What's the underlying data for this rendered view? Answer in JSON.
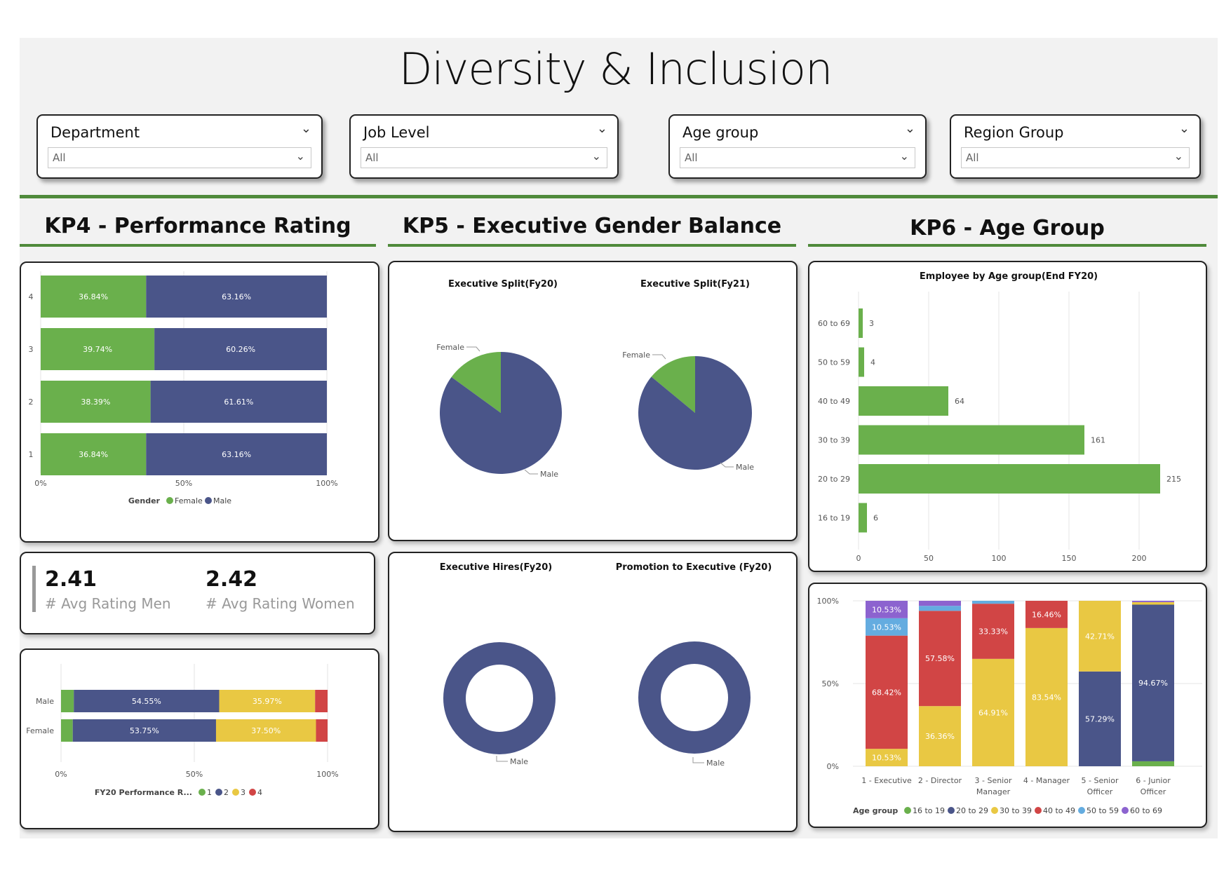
{
  "page_title": "Diversity & Inclusion",
  "filters": [
    {
      "label": "Department",
      "value": "All"
    },
    {
      "label": "Job Level",
      "value": "All"
    },
    {
      "label": "Age group",
      "value": "All"
    },
    {
      "label": "Region Group",
      "value": "All"
    }
  ],
  "sections": {
    "kp4": "KP4 - Performance Rating",
    "kp5": "KP5 - Executive Gender Balance",
    "kp6": "KP6 - Age Group"
  },
  "kpis": {
    "men_value": "2.41",
    "men_label": "# Avg Rating Men",
    "women_value": "2.42",
    "women_label": "# Avg Rating Women"
  },
  "colors": {
    "green": "#6ab04c",
    "blue": "#4a5589",
    "yellow": "#e9c843",
    "red": "#d14545",
    "lightblue": "#64ace0",
    "purple": "#8c63cf"
  },
  "chart_data": [
    {
      "id": "perf-gender",
      "type": "bar",
      "stacked": "100%",
      "orientation": "horizontal",
      "categories": [
        "4",
        "3",
        "2",
        "1"
      ],
      "series": [
        {
          "name": "Female",
          "values": [
            36.84,
            39.74,
            38.39,
            36.84
          ],
          "labels": [
            "36.84%",
            "39.74%",
            "38.39%",
            "36.84%"
          ]
        },
        {
          "name": "Male",
          "values": [
            63.16,
            60.26,
            61.61,
            63.16
          ],
          "labels": [
            "63.16%",
            "60.26%",
            "61.61%",
            "63.16%"
          ]
        }
      ],
      "x_ticks": [
        "0%",
        "50%",
        "100%"
      ],
      "legend_title": "Gender",
      "legend_position": "bottom"
    },
    {
      "id": "rating-by-gender",
      "type": "bar",
      "stacked": "100%",
      "orientation": "horizontal",
      "categories": [
        "Male",
        "Female"
      ],
      "series": [
        {
          "name": "1",
          "values": [
            4.8,
            4.4
          ],
          "labels": [
            "",
            ""
          ]
        },
        {
          "name": "2",
          "values": [
            54.55,
            53.75
          ],
          "labels": [
            "54.55%",
            "53.75%"
          ]
        },
        {
          "name": "3",
          "values": [
            35.97,
            37.5
          ],
          "labels": [
            "35.97%",
            "37.50%"
          ]
        },
        {
          "name": "4",
          "values": [
            4.68,
            4.35
          ],
          "labels": [
            "",
            ""
          ]
        }
      ],
      "x_ticks": [
        "0%",
        "50%",
        "100%"
      ],
      "legend_title": "FY20 Performance R...",
      "legend_position": "bottom"
    },
    {
      "id": "exec-split-fy20",
      "type": "pie",
      "title": "Executive Split(Fy20)",
      "slices": [
        {
          "label": "Female",
          "value": 15
        },
        {
          "label": "Male",
          "value": 85
        }
      ]
    },
    {
      "id": "exec-split-fy21",
      "type": "pie",
      "title": "Executive Split(Fy21)",
      "slices": [
        {
          "label": "Female",
          "value": 14
        },
        {
          "label": "Male",
          "value": 86
        }
      ]
    },
    {
      "id": "exec-hires-fy20",
      "type": "pie",
      "donut": true,
      "title": "Executive Hires(Fy20)",
      "slices": [
        {
          "label": "Male",
          "value": 100
        }
      ]
    },
    {
      "id": "promo-exec-fy20",
      "type": "pie",
      "donut": true,
      "title": "Promotion to Executive (Fy20)",
      "slices": [
        {
          "label": "Male",
          "value": 100
        }
      ]
    },
    {
      "id": "emp-by-age",
      "type": "bar",
      "orientation": "horizontal",
      "title": "Employee by Age group(End FY20)",
      "categories": [
        "60 to 69",
        "50 to 59",
        "40 to 49",
        "30 to 39",
        "20 to 29",
        "16 to 19"
      ],
      "values": [
        3,
        4,
        64,
        161,
        215,
        6
      ],
      "x_ticks": [
        0,
        50,
        100,
        150,
        200
      ],
      "xlim": [
        0,
        240
      ]
    },
    {
      "id": "age-by-level",
      "type": "bar",
      "stacked": "100%",
      "orientation": "vertical",
      "categories": [
        "1 - Executive",
        "2 - Director",
        "3 - Senior Manager",
        "4 - Manager",
        "5 - Senior Officer",
        "6 - Junior Officer"
      ],
      "series": [
        {
          "name": "16 to 19",
          "values": [
            0,
            0,
            0,
            0,
            0,
            3.0
          ],
          "labels": [
            "",
            "",
            "",
            "",
            "",
            ""
          ]
        },
        {
          "name": "20 to 29",
          "values": [
            0,
            0,
            0,
            0,
            57.29,
            94.67
          ],
          "labels": [
            "",
            "",
            "",
            "",
            "57.29%",
            "94.67%"
          ]
        },
        {
          "name": "30 to 39",
          "values": [
            10.53,
            36.36,
            64.91,
            83.54,
            42.71,
            1.5
          ],
          "labels": [
            "10.53%",
            "36.36%",
            "64.91%",
            "83.54%",
            "42.71%",
            ""
          ]
        },
        {
          "name": "40 to 49",
          "values": [
            68.42,
            57.58,
            33.33,
            16.46,
            0,
            0
          ],
          "labels": [
            "68.42%",
            "57.58%",
            "33.33%",
            "16.46%",
            "",
            ""
          ]
        },
        {
          "name": "50 to 59",
          "values": [
            10.53,
            3.0,
            1.76,
            0,
            0,
            0
          ],
          "labels": [
            "10.53%",
            "",
            "",
            "",
            "",
            ""
          ]
        },
        {
          "name": "60 to 69",
          "values": [
            10.53,
            3.06,
            0,
            0,
            0,
            0.83
          ],
          "labels": [
            "10.53%",
            "",
            "",
            "",
            "",
            ""
          ]
        }
      ],
      "y_ticks": [
        "100%",
        "50%",
        "0%"
      ],
      "legend_title": "Age group",
      "legend_position": "bottom"
    }
  ]
}
